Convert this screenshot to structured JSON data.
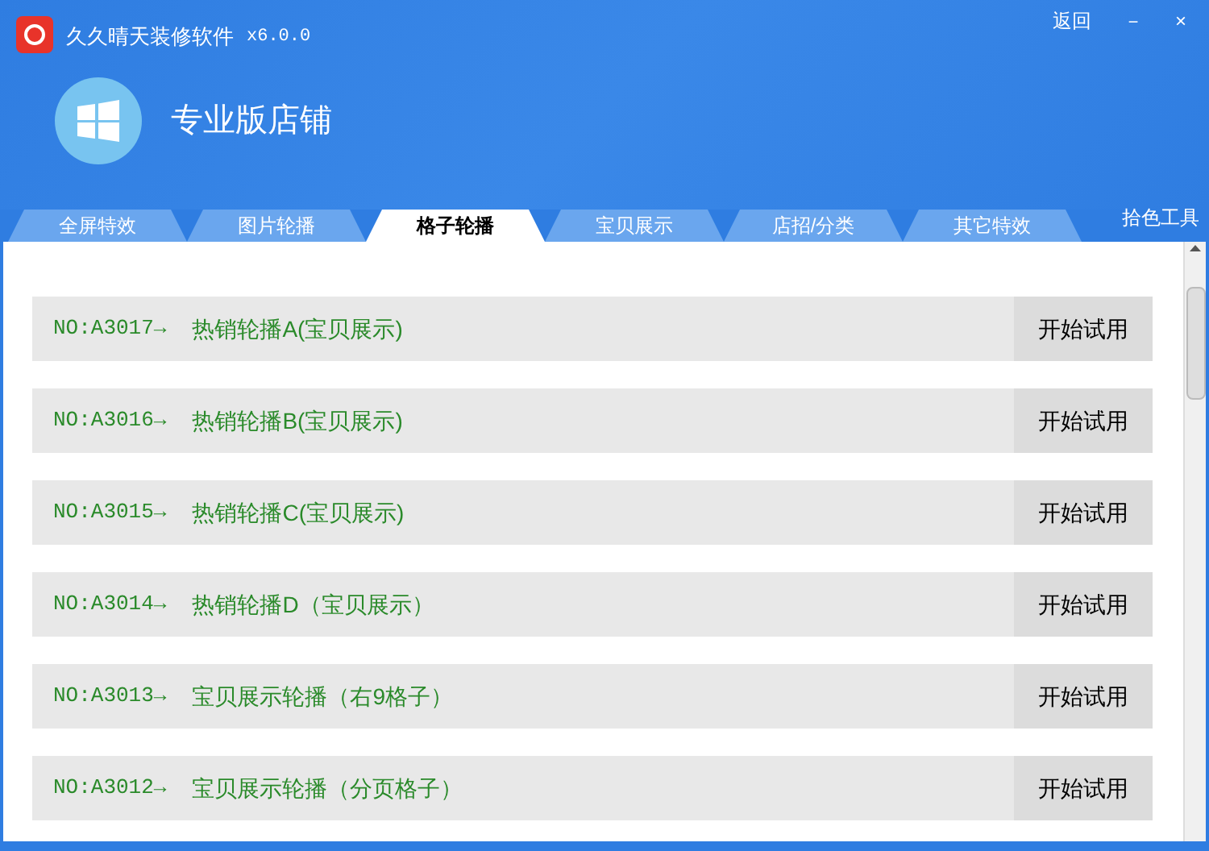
{
  "window": {
    "title": "久久晴天装修软件",
    "version": "x6.0.0",
    "controls": [
      "返回",
      "－",
      "×"
    ]
  },
  "banner": {
    "title": "专业版店铺"
  },
  "tabs": [
    {
      "label": "全屏特效",
      "selected": false
    },
    {
      "label": "图片轮播",
      "selected": false
    },
    {
      "label": "格子轮播",
      "selected": true
    },
    {
      "label": "宝贝展示",
      "selected": false
    },
    {
      "label": "店招/分类",
      "selected": false
    },
    {
      "label": "其它特效",
      "selected": false
    }
  ],
  "tool_link": "拾色工具",
  "items": [
    {
      "code": "NO:A3017→",
      "name": "热销轮播A(宝贝展示)",
      "button": "开始试用"
    },
    {
      "code": "NO:A3016→",
      "name": "热销轮播B(宝贝展示)",
      "button": "开始试用"
    },
    {
      "code": "NO:A3015→",
      "name": "热销轮播C(宝贝展示)",
      "button": "开始试用"
    },
    {
      "code": "NO:A3014→",
      "name": "热销轮播D（宝贝展示）",
      "button": "开始试用"
    },
    {
      "code": "NO:A3013→",
      "name": "宝贝展示轮播（右9格子）",
      "button": "开始试用"
    },
    {
      "code": "NO:A3012→",
      "name": "宝贝展示轮播（分页格子）",
      "button": "开始试用"
    }
  ]
}
